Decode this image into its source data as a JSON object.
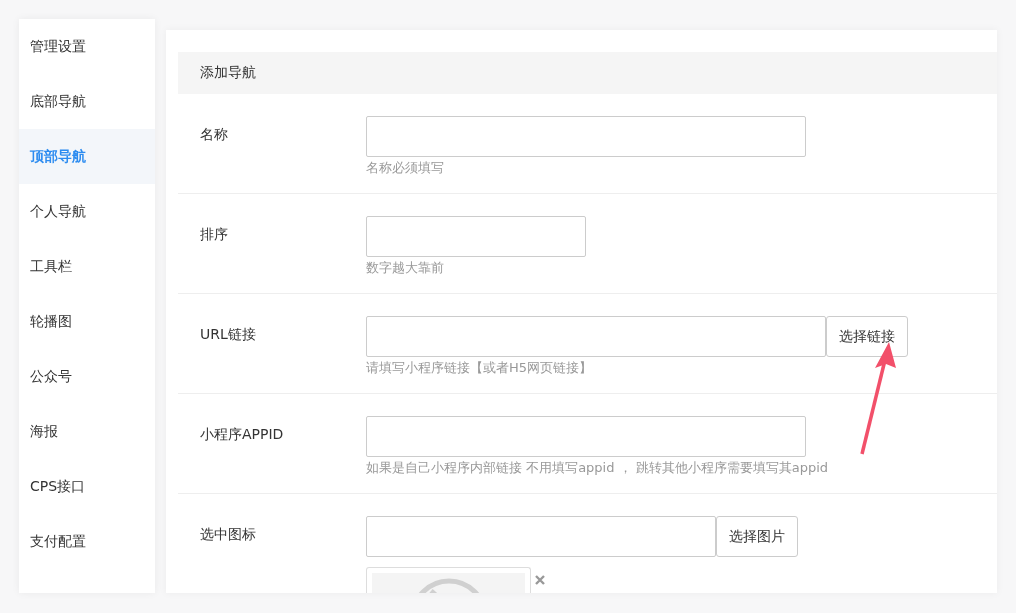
{
  "sidebar": {
    "items": [
      {
        "label": "管理设置",
        "selected": false
      },
      {
        "label": "底部导航",
        "selected": false
      },
      {
        "label": "顶部导航",
        "selected": true
      },
      {
        "label": "个人导航",
        "selected": false
      },
      {
        "label": "工具栏",
        "selected": false
      },
      {
        "label": "轮播图",
        "selected": false
      },
      {
        "label": "公众号",
        "selected": false
      },
      {
        "label": "海报",
        "selected": false
      },
      {
        "label": "CPS接口",
        "selected": false
      },
      {
        "label": "支付配置",
        "selected": false
      }
    ]
  },
  "form": {
    "title": "添加导航",
    "fields": [
      {
        "kind": "input",
        "label": "名称",
        "hint": "名称必须填写"
      },
      {
        "kind": "short",
        "label": "排序",
        "hint": "数字越大靠前"
      },
      {
        "kind": "button",
        "label": "URL链接",
        "button": "选择链接",
        "hint": "请填写小程序链接【或者H5网页链接】"
      },
      {
        "kind": "input",
        "label": "小程序APPID",
        "hint": "如果是自己小程序内部链接 不用填写appid ， 跳转其他小程序需要填写其appid"
      },
      {
        "kind": "image",
        "label": "选中图标",
        "button": "选择图片"
      }
    ]
  }
}
